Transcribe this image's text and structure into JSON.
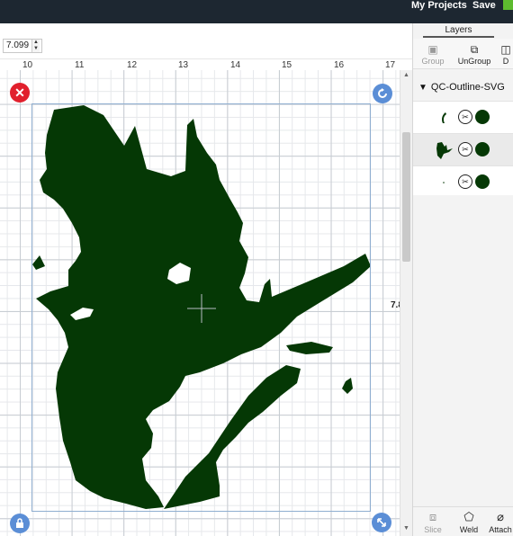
{
  "topbar": {
    "my_projects": "My Projects",
    "save": "Save",
    "accent_color": "#5dbb2f"
  },
  "size_field": {
    "value": "7.099"
  },
  "ruler": {
    "ticks": [
      "10",
      "11",
      "12",
      "13",
      "14",
      "15",
      "16",
      "17"
    ]
  },
  "canvas": {
    "dimension_label": "7.8",
    "shape_color": "#053805",
    "selection_color": "#8faed0",
    "icons": [
      "delete-icon",
      "rotate-icon",
      "lock-icon",
      "resize-icon"
    ]
  },
  "layers_panel": {
    "tab_label": "Layers",
    "actions": {
      "group": "Group",
      "ungroup": "UnGroup",
      "detach": "D"
    },
    "group_name": "QC-Outline-SVG",
    "layers": [
      {
        "cut_icon": "scissors-icon",
        "color": "#053805"
      },
      {
        "cut_icon": "scissors-icon",
        "color": "#053805"
      },
      {
        "cut_icon": "scissors-icon",
        "color": "#053805"
      }
    ],
    "bottom_actions": {
      "slice": "Slice",
      "weld": "Weld",
      "attach": "Attach"
    }
  }
}
